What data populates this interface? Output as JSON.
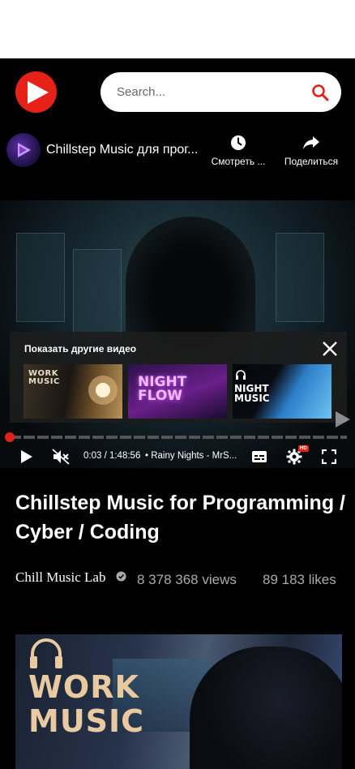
{
  "header": {
    "search_placeholder": "Search...",
    "accent_color": "#e62117"
  },
  "channel_strip": {
    "title": "Chillstep Music для прог...",
    "watch_later_label": "Смотреть ...",
    "share_label": "Поделиться"
  },
  "player": {
    "more_videos_title": "Показать другие видео",
    "suggestions": [
      {
        "label": "WORK MUSIC"
      },
      {
        "label": "NIGHT FLOW"
      },
      {
        "label": "NIGHT MUSIC"
      }
    ],
    "progress_fraction": 0.0003,
    "time_text": "0:03 / 1:48:56",
    "track_text": "• Rainy Nights - MrS...",
    "hd_badge": "HD",
    "icons": [
      "play-icon",
      "mute-icon",
      "subtitles-icon",
      "settings-icon",
      "fullscreen-icon",
      "close-icon"
    ]
  },
  "video": {
    "title": "Chillstep Music for Programming / Cyber / Coding",
    "channel_name": "Chill Music Lab",
    "views": "8 378 368 views",
    "likes": "89 183 likes"
  },
  "next_card": {
    "label": "WORK MUSIC"
  }
}
